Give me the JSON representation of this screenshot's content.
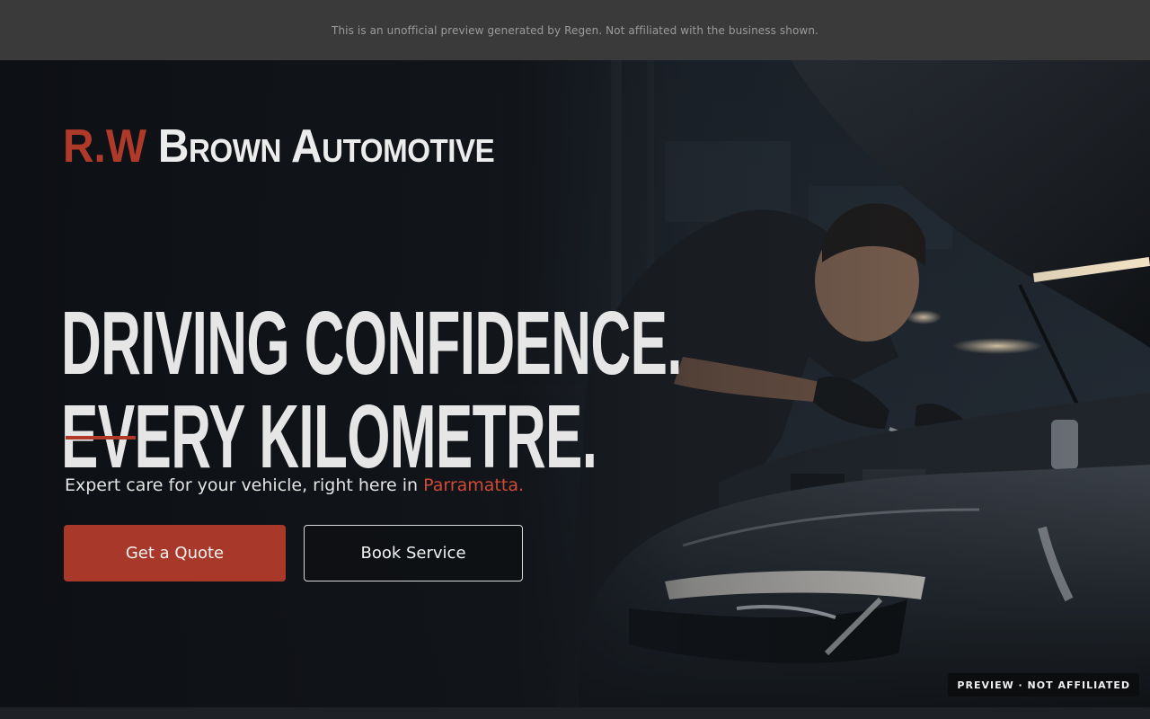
{
  "banner": {
    "notice": "This is an unofficial preview generated by Regen. Not affiliated with the business shown."
  },
  "brand": {
    "mark": "R.W",
    "name": "Brown Automotive"
  },
  "hero": {
    "headline_line1": "DRIVING CONFIDENCE.",
    "headline_line2": "EVERY KILOMETRE.",
    "tagline_prefix": "Expert care for your vehicle, right here in ",
    "tagline_location": "Parramatta."
  },
  "actions": {
    "quote_label": "Get a Quote",
    "book_label": "Book Service"
  },
  "badge": {
    "label": "PREVIEW · NOT AFFILIATED"
  },
  "colors": {
    "accent": "#b03a29",
    "accent_text": "#d04a35",
    "topbar": "#3a3a3a",
    "hero_bg": "#111418"
  },
  "illustration": {
    "subject": "mechanic working under open car hood",
    "icon": "mechanic-car-illustration"
  }
}
